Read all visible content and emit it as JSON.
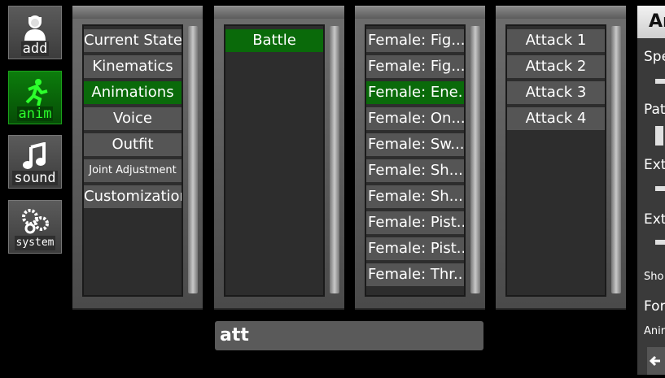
{
  "tools": [
    {
      "label": "add",
      "icon": "person-icon"
    },
    {
      "label": "anim",
      "icon": "running-figure-icon",
      "active": true
    },
    {
      "label": "sound",
      "icon": "music-note-icon"
    },
    {
      "label": "system",
      "icon": "gears-icon"
    }
  ],
  "categories": [
    "Current State",
    "Kinematics",
    "Animations",
    "Voice",
    "Outfit",
    "Joint Adjustment",
    "Customization"
  ],
  "category_selected": "Animations",
  "groups": [
    "Battle"
  ],
  "animations": [
    "Female: Fig...",
    "Female: Fig...",
    "Female: Ene...",
    "Female: On...",
    "Female: Sw...",
    "Female: Sh...",
    "Female: Sh...",
    "Female: Pist...",
    "Female: Pist...",
    "Female: Thr..."
  ],
  "attacks": [
    "Attack 1",
    "Attack 2",
    "Attack 3",
    "Attack 4"
  ],
  "search": {
    "value": "att"
  },
  "right_panel": {
    "title": "An",
    "labels": [
      "Spe",
      "Pat",
      "Ext",
      "Ext",
      "Sho",
      "For",
      "Anin"
    ]
  }
}
